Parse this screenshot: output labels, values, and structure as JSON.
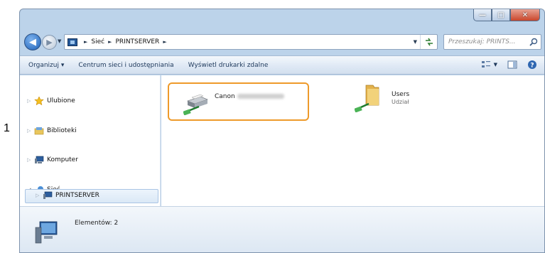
{
  "outer_label": "1",
  "window": {
    "caption_buttons": {
      "minimize": "—",
      "maximize": "□",
      "close": "✕"
    }
  },
  "address": {
    "crumbs": [
      "Sieć",
      "PRINTSERVER"
    ],
    "search_placeholder": "Przeszukaj: PRINTS..."
  },
  "toolbar": {
    "organize": "Organizuj ▾",
    "network_center": "Centrum sieci i udostępniania",
    "remote_printers": "Wyświetl drukarki zdalne"
  },
  "navpane": {
    "items": [
      {
        "label": "Ulubione"
      },
      {
        "label": "Biblioteki"
      },
      {
        "label": "Komputer"
      },
      {
        "label": "Sieć"
      },
      {
        "label": "PRINTSERVER"
      }
    ]
  },
  "content": {
    "printer": {
      "name": "Canon"
    },
    "folder": {
      "name": "Users",
      "subtitle": "Udział"
    }
  },
  "details": {
    "count_text": "Elementów: 2"
  },
  "colors": {
    "highlight": "#ee9a2a",
    "toolbar_text": "#1e395b",
    "window_frame": "#bcd3ea"
  }
}
